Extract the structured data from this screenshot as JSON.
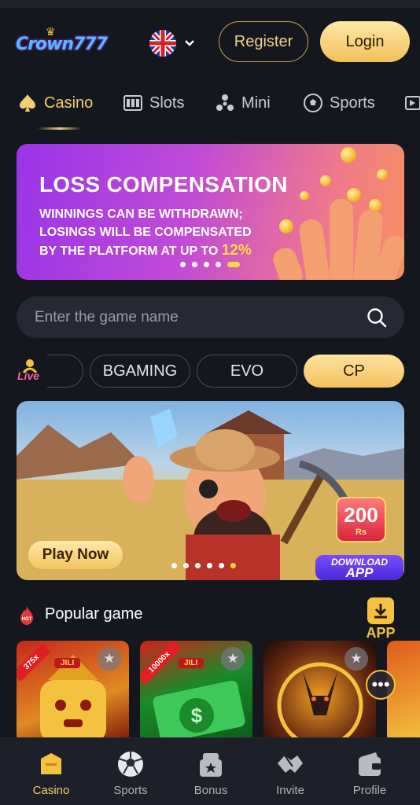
{
  "header": {
    "logo_text": "Crown777",
    "register_label": "Register",
    "login_label": "Login",
    "language": "English"
  },
  "tabs": [
    {
      "label": "Casino",
      "icon": "spade-icon",
      "active": true
    },
    {
      "label": "Slots",
      "icon": "slot-machine-icon",
      "active": false
    },
    {
      "label": "Mini",
      "icon": "mini-games-icon",
      "active": false
    },
    {
      "label": "Sports",
      "icon": "soccer-ball-icon",
      "active": false
    }
  ],
  "promo_banner": {
    "title": "LOSS COMPENSATION",
    "line1": "WINNINGS CAN BE WITHDRAWN;",
    "line2": "LOSINGS WILL BE COMPENSATED",
    "line3_prefix": "BY THE PLATFORM AT UP TO ",
    "line3_highlight": "12%",
    "slide_count": 5,
    "active_slide": 5
  },
  "search": {
    "placeholder": "Enter the game name"
  },
  "providers": {
    "live_label": "Live",
    "items": [
      "BGAMING",
      "EVO",
      "CP"
    ],
    "active": "CP"
  },
  "game_banner": {
    "play_label": "Play Now",
    "bonus_amount": "200",
    "bonus_currency": "Rs",
    "download_line1": "DOWNLOAD",
    "download_line2": "APP",
    "slide_count": 6,
    "active_slide": 6
  },
  "popular": {
    "title": "Popular game",
    "hot_label": "HOT",
    "app_label": "APP",
    "cards": [
      {
        "provider": "JILI",
        "multiplier": "375x"
      },
      {
        "provider": "JILI",
        "multiplier": "10000x"
      },
      {
        "provider": "",
        "multiplier": ""
      },
      {
        "provider": "",
        "multiplier": ""
      }
    ]
  },
  "bottom_nav": [
    {
      "label": "Casino",
      "icon": "casino-icon",
      "active": true
    },
    {
      "label": "Sports",
      "icon": "soccer-ball-icon",
      "active": false
    },
    {
      "label": "Bonus",
      "icon": "gift-icon",
      "active": false
    },
    {
      "label": "Invite",
      "icon": "handshake-icon",
      "active": false
    },
    {
      "label": "Profile",
      "icon": "wallet-icon",
      "active": false
    }
  ],
  "colors": {
    "accent": "#f4cc72",
    "background": "#15171f",
    "surface": "#262933"
  }
}
